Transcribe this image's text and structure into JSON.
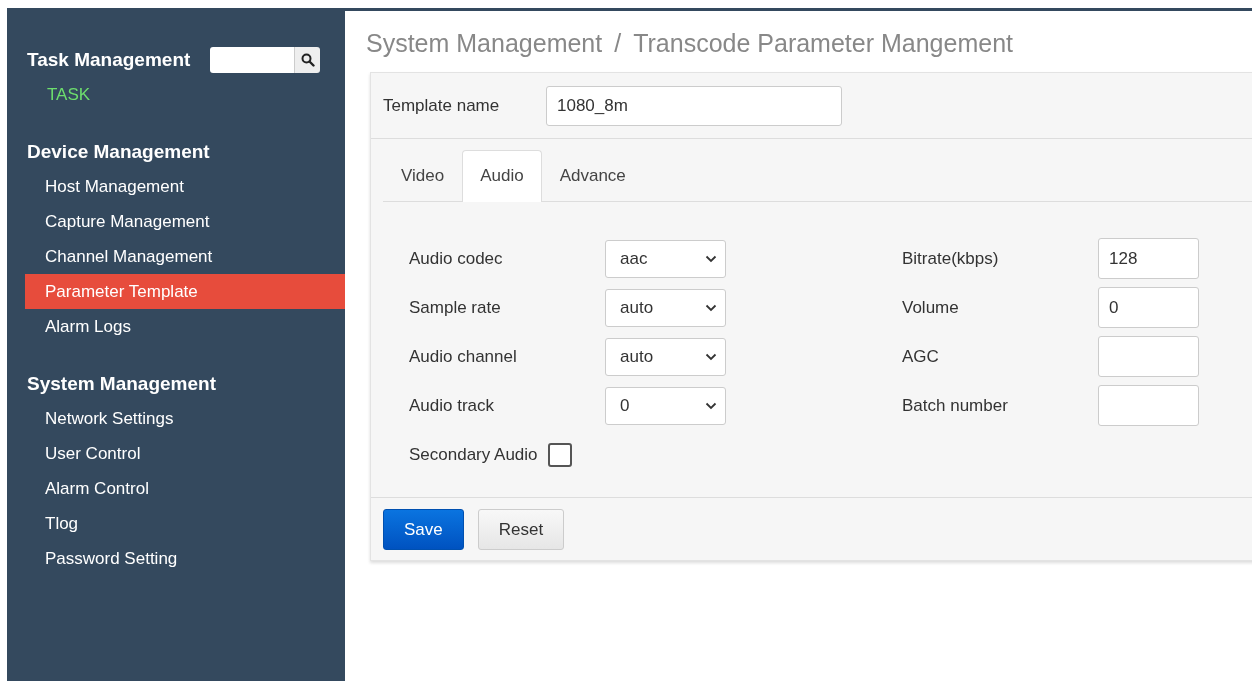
{
  "sidebar": {
    "sections": [
      {
        "title": "Task Management",
        "items": [
          {
            "label": "TASK",
            "kind": "link",
            "selected": false
          }
        ]
      },
      {
        "title": "Device Management",
        "items": [
          {
            "label": "Host Management",
            "kind": "item",
            "selected": false
          },
          {
            "label": "Capture Management",
            "kind": "item",
            "selected": false
          },
          {
            "label": "Channel Management",
            "kind": "item",
            "selected": false
          },
          {
            "label": "Parameter Template",
            "kind": "item",
            "selected": true
          },
          {
            "label": "Alarm Logs",
            "kind": "item",
            "selected": false
          }
        ]
      },
      {
        "title": "System Management",
        "items": [
          {
            "label": "Network Settings",
            "kind": "item",
            "selected": false
          },
          {
            "label": "User Control",
            "kind": "item",
            "selected": false
          },
          {
            "label": "Alarm Control",
            "kind": "item",
            "selected": false
          },
          {
            "label": "Tlog",
            "kind": "item",
            "selected": false
          },
          {
            "label": "Password Setting",
            "kind": "item",
            "selected": false
          }
        ]
      }
    ]
  },
  "breadcrumb": [
    "System Management",
    "/",
    "Transcode Parameter Mangement"
  ],
  "template_name": {
    "label": "Template name",
    "value": "1080_8m"
  },
  "tabs": [
    {
      "label": "Video",
      "selected": false
    },
    {
      "label": "Audio",
      "selected": true
    },
    {
      "label": "Advance",
      "selected": false
    }
  ],
  "left_fields": [
    {
      "label": "Audio codec",
      "kind": "select",
      "value": "aac"
    },
    {
      "label": "Sample rate",
      "kind": "select",
      "value": "auto"
    },
    {
      "label": "Audio channel",
      "kind": "select",
      "value": "auto"
    },
    {
      "label": "Audio track",
      "kind": "select",
      "value": "0"
    },
    {
      "label": "Secondary Audio",
      "kind": "checkbox",
      "checked": false
    }
  ],
  "right_fields": [
    {
      "label": "Bitrate(kbps)",
      "value": "128"
    },
    {
      "label": "Volume",
      "value": "0"
    },
    {
      "label": "AGC"
    },
    {
      "label": "Batch number"
    }
  ],
  "buttons": [
    {
      "label": "Save",
      "kind": "primary"
    },
    {
      "label": "Reset",
      "kind": "default"
    }
  ]
}
